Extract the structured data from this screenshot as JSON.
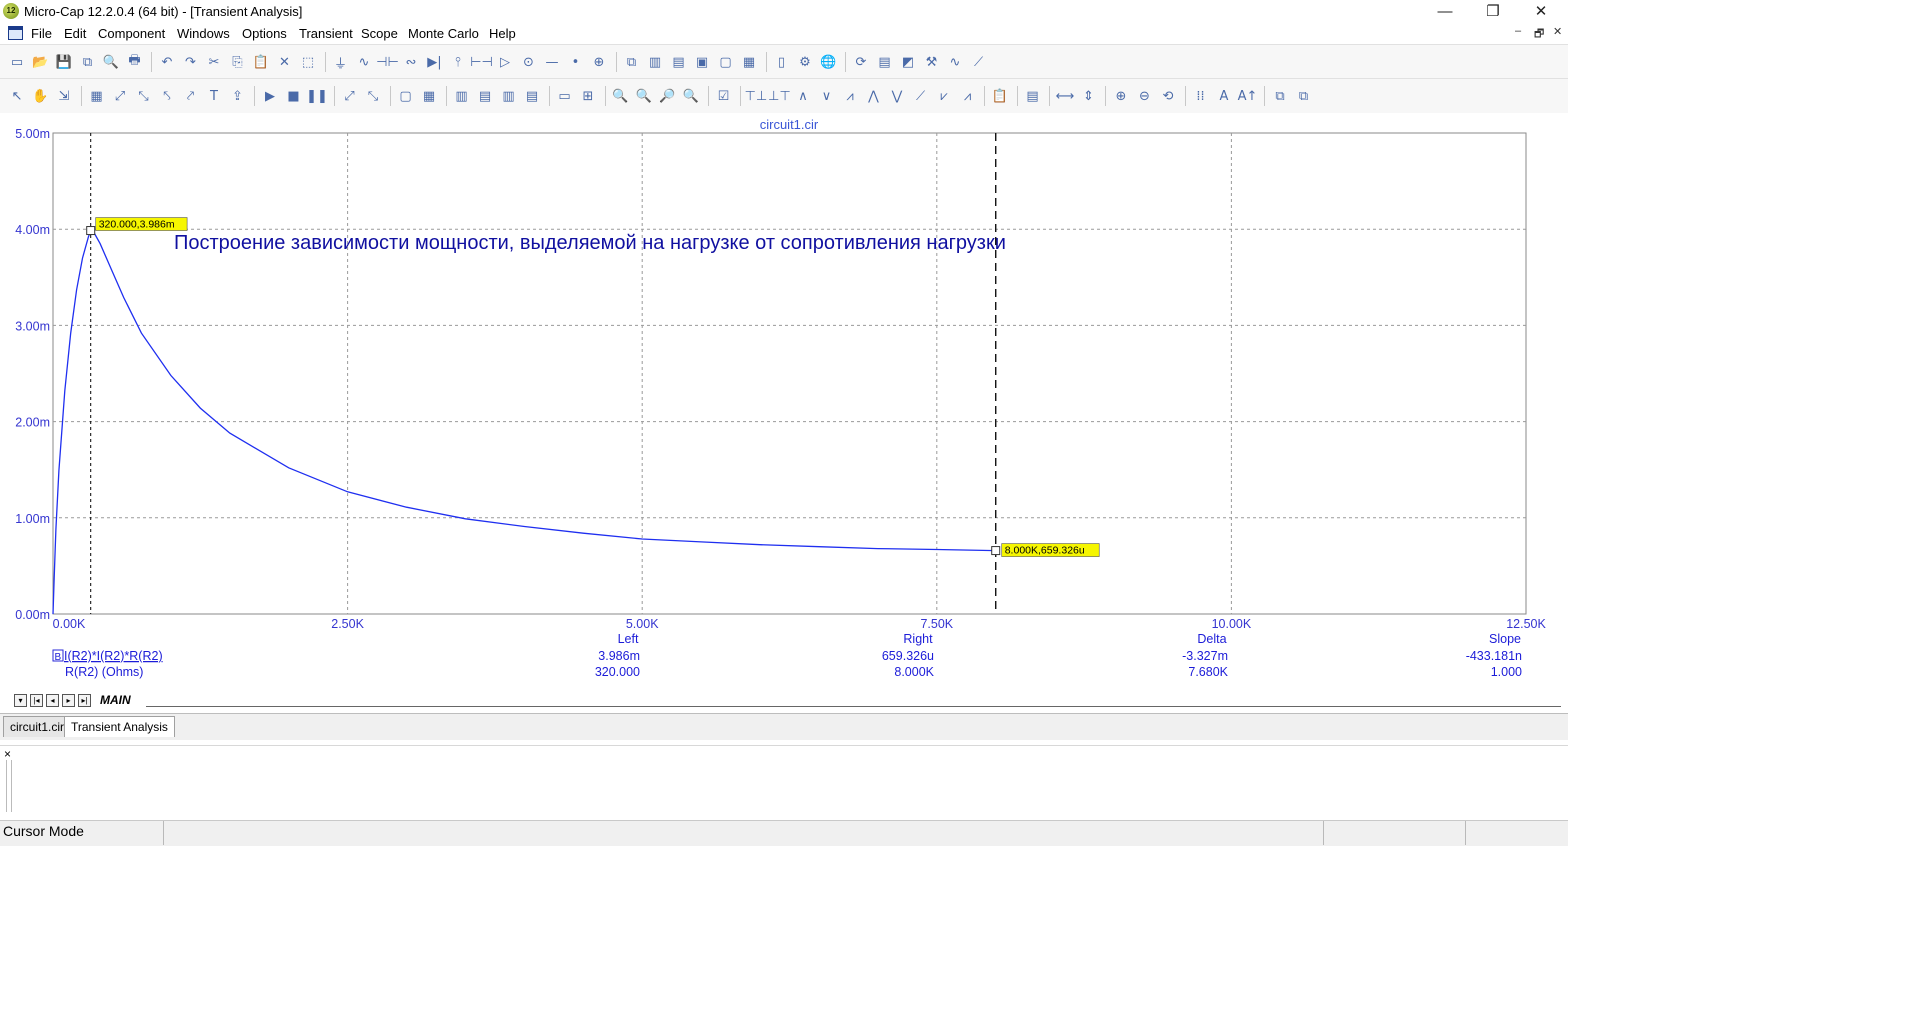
{
  "window": {
    "app_icon": "12",
    "title": "Micro-Cap 12.2.0.4 (64 bit) - [Transient Analysis]",
    "minimize": "—",
    "maximize": "❐",
    "close": "✕"
  },
  "menu": {
    "items": [
      "File",
      "Edit",
      "Component",
      "Windows",
      "Options",
      "Transient",
      "Scope",
      "Monte Carlo",
      "Help"
    ],
    "mdi_minimize": "–",
    "mdi_restore": "🗗",
    "mdi_close": "✕"
  },
  "toolbar1": {
    "icons": [
      "new-icon",
      "open-icon",
      "save-icon",
      "save-all-icon",
      "print-preview-icon",
      "print-icon",
      "|",
      "undo-icon",
      "redo-icon",
      "cut-icon",
      "copy-icon",
      "paste-icon",
      "delete-icon",
      "select-all-icon",
      "|",
      "ground-icon",
      "resistor-icon",
      "capacitor-icon",
      "inductor-icon",
      "diode-icon",
      "transistor-icon",
      "battery-icon",
      "opamp-icon",
      "source-icon",
      "wire-icon",
      "node-icon",
      "probe-icon",
      "|",
      "cascade-icon",
      "tile-vertical-icon",
      "tile-horizontal-icon",
      "restore-icon",
      "maximize-icon",
      "calculator-icon",
      "|",
      "page-icon",
      "component-editor-icon",
      "globe-icon",
      "|",
      "shape-editor-icon",
      "package-icon",
      "model-icon",
      "tools-icon",
      "analysis-icon",
      "limits-icon"
    ],
    "glyphs": [
      "▭",
      "📂",
      "💾",
      "⧉",
      "🔍",
      "🖶",
      "|",
      "↶",
      "↷",
      "✂",
      "⎘",
      "📋",
      "✕",
      "⬚",
      "|",
      "⏚",
      "∿",
      "⊣⊢",
      "∾",
      "▶|",
      "⫯",
      "⊢⊣",
      "▷",
      "⊙",
      "—",
      "•",
      "⊕",
      "|",
      "⧉",
      "▥",
      "▤",
      "▣",
      "▢",
      "▦",
      "|",
      "▯",
      "⚙",
      "🌐",
      "|",
      "⟳",
      "▤",
      "◩",
      "⚒",
      "∿",
      "⟋"
    ]
  },
  "toolbar2": {
    "icons": [
      "select-mode-icon",
      "pan-icon",
      "info-icon",
      "|",
      "plot-icon",
      "scope-a-icon",
      "scope-b-icon",
      "scope-c-icon",
      "scope-d-icon",
      "text-tool-icon",
      "export-icon",
      "|",
      "run-icon",
      "stop-icon",
      "pause-icon",
      "|",
      "cursor-left-icon",
      "cursor-right-icon",
      "|",
      "box-icon",
      "grid-icon",
      "|",
      "panel1-icon",
      "panel2-icon",
      "panel3-icon",
      "panel4-icon",
      "|",
      "hline-icon",
      "cross-icon",
      "|",
      "zoom-fit-icon",
      "zoom-area-icon",
      "zoom-x-icon",
      "zoom-out-icon",
      "|",
      "properties-icon",
      "|",
      "peak-icon",
      "valley-icon",
      "high-icon",
      "low-icon",
      "inflection-icon",
      "global-high-icon",
      "global-low-icon",
      "slope-icon",
      "tag-icon",
      "point-tag-icon",
      "|",
      "clipboard-icon",
      "|",
      "notes-icon",
      "|",
      "scale-icon",
      "numbers-icon",
      "|",
      "zoom-in-icon",
      "zoom-minus-icon",
      "zoom-back-icon",
      "|",
      "align-icon",
      "font-icon",
      "text-size-icon",
      "|",
      "copy-plot-icon",
      "paste-plot-icon"
    ],
    "glyphs": [
      "↖",
      "✋",
      "⇲",
      "|",
      "▦",
      "⤢",
      "⤡",
      "⤣",
      "⤤",
      "T",
      "⇪",
      "|",
      "▶",
      "■",
      "❚❚",
      "|",
      "⤢",
      "⤡",
      "|",
      "▢",
      "▦",
      "|",
      "▥",
      "▤",
      "▥",
      "▤",
      "|",
      "▭",
      "⊞",
      "|",
      "🔍",
      "🔍",
      "🔎",
      "🔍",
      "|",
      "☑",
      "|",
      "⊤⊥",
      "⊥⊤",
      "∧",
      "∨",
      "⩘",
      "⋀",
      "⋁",
      "⟋",
      "⩗",
      "⩘",
      "|",
      "📋",
      "|",
      "▤",
      "|",
      "⟷",
      "⇕",
      "|",
      "⊕",
      "⊖",
      "⟲",
      "|",
      "⁞⁞",
      "A",
      "A↑",
      "|",
      "⧉",
      "⧉"
    ]
  },
  "plot": {
    "title": "circuit1.cir",
    "annotation": "Построение зависимости мощности, выделяемой на нагрузке от сопротивления нагрузки",
    "colors": {
      "curve": "#1f2ff0",
      "grid": "#9a9a9a",
      "axis_text": "#3535d0",
      "tag_bg": "#f6f600"
    },
    "cursor_tag_left": "320.000,3.986m",
    "cursor_tag_right": "8.000K,659.326u"
  },
  "chart_data": {
    "type": "line",
    "title": "circuit1.cir",
    "xlabel": "R(R2) (Ohms)",
    "ylabel": "I(R2)*I(R2)*R(R2)",
    "xlim": [
      0,
      12500
    ],
    "ylim": [
      0,
      0.005
    ],
    "x_tick_labels": [
      "0.00K",
      "2.50K",
      "5.00K",
      "7.50K",
      "10.00K",
      "12.50K"
    ],
    "y_tick_labels": [
      "0.00m",
      "1.00m",
      "2.00m",
      "3.00m",
      "4.00m",
      "5.00m"
    ],
    "x_ticks": [
      0,
      2500,
      5000,
      7500,
      10000,
      12500
    ],
    "y_ticks": [
      0,
      0.001,
      0.002,
      0.003,
      0.004,
      0.005
    ],
    "grid": true,
    "series": [
      {
        "name": "I(R2)*I(R2)*R(R2)",
        "x": [
          0,
          10,
          25,
          50,
          100,
          150,
          200,
          250,
          300,
          320,
          350,
          400,
          500,
          600,
          750,
          1000,
          1250,
          1500,
          2000,
          2500,
          3000,
          3500,
          4000,
          4500,
          5000,
          5500,
          6000,
          6500,
          7000,
          7500,
          8000
        ],
        "y": [
          0,
          0.00038,
          0.00088,
          0.00149,
          0.00232,
          0.00292,
          0.00337,
          0.0037,
          0.00392,
          0.003986,
          0.00396,
          0.00385,
          0.00357,
          0.00329,
          0.00292,
          0.00248,
          0.00214,
          0.00188,
          0.00152,
          0.00127,
          0.00111,
          0.00099,
          0.00091,
          0.00084,
          0.00078,
          0.00075,
          0.00072,
          0.0007,
          0.00068,
          0.00067,
          0.000659326
        ]
      }
    ],
    "cursors": {
      "left_x": 320,
      "right_x": 8000
    }
  },
  "readout": {
    "headers": [
      "Left",
      "Right",
      "Delta",
      "Slope"
    ],
    "rows": [
      {
        "label": "I(R2)*I(R2)*R(R2)",
        "values": [
          "3.986m",
          "659.326u",
          "-3.327m",
          "-433.181n"
        ]
      },
      {
        "label": "R(R2) (Ohms)",
        "values": [
          "320.000",
          "8.000K",
          "7.680K",
          "1.000"
        ]
      }
    ]
  },
  "sheet_tabs": {
    "active": "MAIN",
    "nav": [
      "▾",
      "|◂",
      "◂",
      "▸",
      "▸|"
    ]
  },
  "doc_tabs": [
    "circuit1.cir",
    "Transient Analysis"
  ],
  "output_pane": {
    "close": "×"
  },
  "status": {
    "mode": "Cursor Mode"
  }
}
